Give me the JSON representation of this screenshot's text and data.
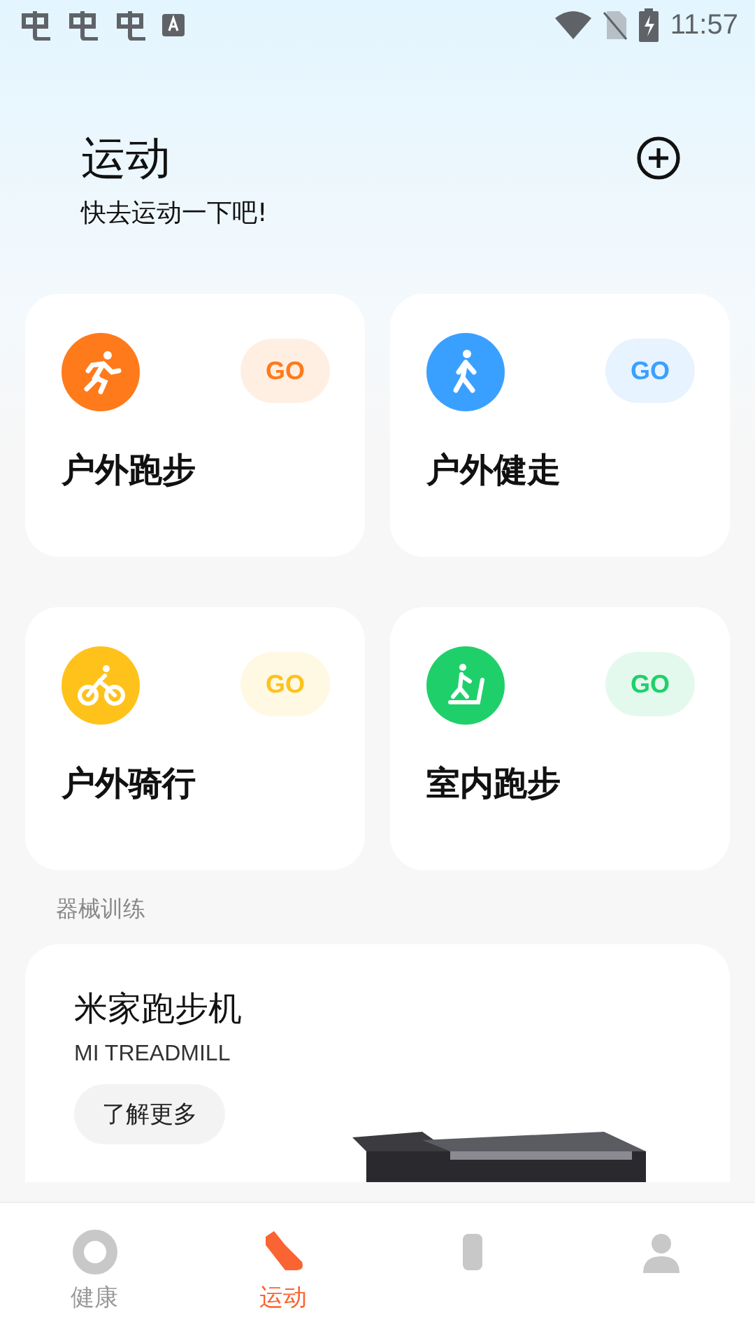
{
  "status_bar": {
    "time": "11:57"
  },
  "header": {
    "title": "运动",
    "subtitle": "快去运动一下吧!"
  },
  "sports": [
    {
      "name": "户外跑步",
      "kind": "run",
      "color": "#ff7a1a",
      "go": "GO"
    },
    {
      "name": "户外健走",
      "kind": "walk",
      "color": "#3aa0ff",
      "go": "GO"
    },
    {
      "name": "户外骑行",
      "kind": "cycle",
      "color": "#ffc21a",
      "go": "GO"
    },
    {
      "name": "室内跑步",
      "kind": "treadmill",
      "color": "#1fd06a",
      "go": "GO"
    }
  ],
  "section_label": "器械训练",
  "equipment": {
    "title": "米家跑步机",
    "subtitle": "MI TREADMILL",
    "button": "了解更多",
    "kind": "picture"
  },
  "tabs": [
    {
      "label": "健康",
      "kind": "ring",
      "selected": false
    },
    {
      "label": "运动",
      "kind": "shoe",
      "selected": true
    },
    {
      "kind": "device",
      "selected": false
    },
    {
      "kind": "person",
      "selected": false
    }
  ]
}
